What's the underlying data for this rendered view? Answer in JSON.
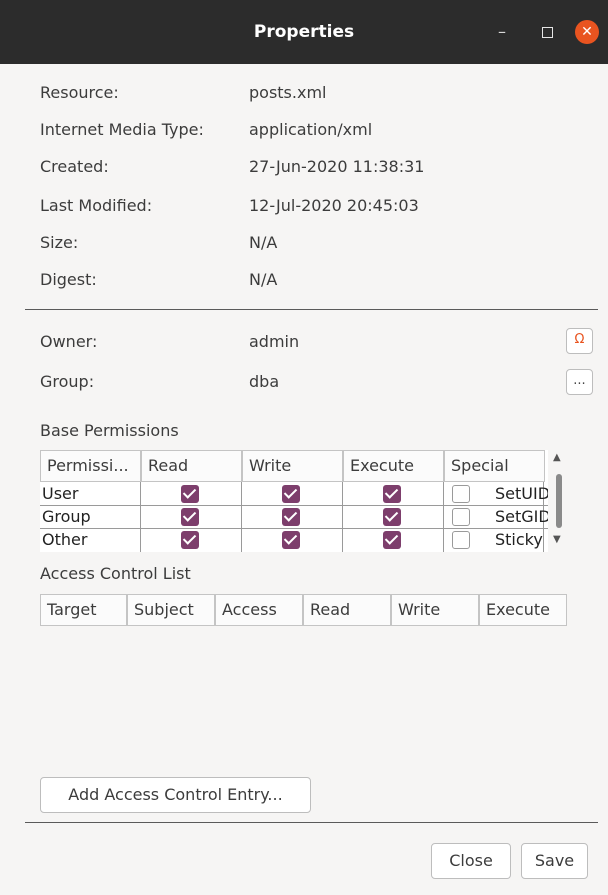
{
  "window": {
    "title": "Properties",
    "minimize_glyph": "–",
    "close_glyph": "✕"
  },
  "info": {
    "resource": {
      "label": "Resource:",
      "value": "posts.xml"
    },
    "media_type": {
      "label": "Internet Media Type:",
      "value": "application/xml"
    },
    "created": {
      "label": "Created:",
      "value": "27-Jun-2020 11:38:31"
    },
    "modified": {
      "label": "Last Modified:",
      "value": "12-Jul-2020 20:45:03"
    },
    "size": {
      "label": "Size:",
      "value": "N/A"
    },
    "digest": {
      "label": "Digest:",
      "value": "N/A"
    }
  },
  "ownership": {
    "owner": {
      "label": "Owner:",
      "value": "admin",
      "button_icon": "user-icon"
    },
    "group": {
      "label": "Group:",
      "value": "dba",
      "button_label": "..."
    }
  },
  "base_permissions": {
    "title": "Base Permissions",
    "headers": [
      "Permissi...",
      "Read",
      "Write",
      "Execute",
      "Special"
    ],
    "rows": [
      {
        "name": "User",
        "read": true,
        "write": true,
        "execute": true,
        "special_checked": false,
        "special": "SetUID"
      },
      {
        "name": "Group",
        "read": true,
        "write": true,
        "execute": true,
        "special_checked": false,
        "special": "SetGID"
      },
      {
        "name": "Other",
        "read": true,
        "write": true,
        "execute": true,
        "special_checked": false,
        "special": "Sticky"
      }
    ]
  },
  "acl": {
    "title": "Access Control List",
    "headers": [
      "Target",
      "Subject",
      "Access",
      "Read",
      "Write",
      "Execute"
    ]
  },
  "buttons": {
    "add_ace": "Add Access Control Entry...",
    "close": "Close",
    "save": "Save"
  },
  "colors": {
    "titlebar": "#2c2c2c",
    "close_button": "#e95420",
    "checkbox": "#7d3e6c",
    "background": "#f6f5f4"
  }
}
